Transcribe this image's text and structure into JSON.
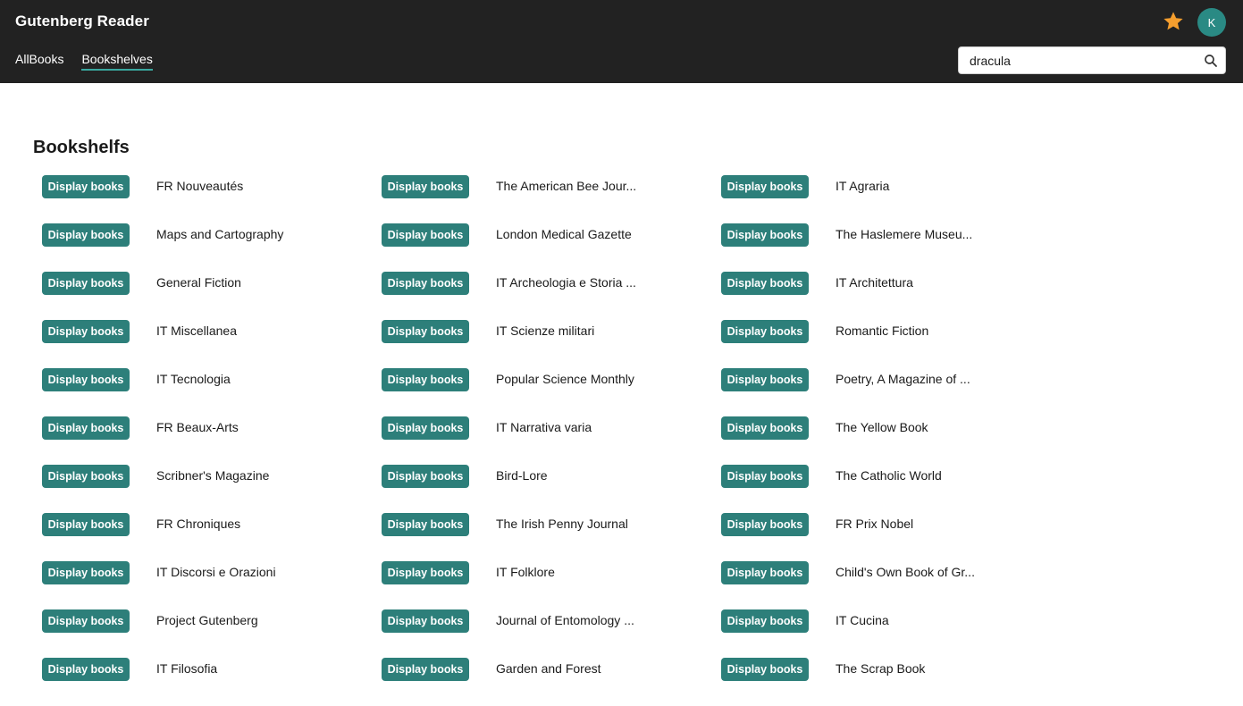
{
  "header": {
    "title": "Gutenberg Reader",
    "nav": [
      {
        "label": "AllBooks",
        "active": false
      },
      {
        "label": "Bookshelves",
        "active": true
      }
    ],
    "favorites_icon": "star-icon",
    "favorites_color": "#f59e2e",
    "avatar_initial": "K",
    "search": {
      "value": "dracula",
      "placeholder": "",
      "icon": "search-icon"
    }
  },
  "section": {
    "title": "Bookshelfs"
  },
  "button_label": "Display books",
  "colors": {
    "topbar": "#222222",
    "accent": "#2d7f7a",
    "nav_underline": "#3aa8a0"
  },
  "shelves": [
    {
      "name": "FR Nouveautés"
    },
    {
      "name": "The American Bee Jour..."
    },
    {
      "name": "IT Agraria"
    },
    {
      "name": "Maps and Cartography"
    },
    {
      "name": "London Medical Gazette"
    },
    {
      "name": "The Haslemere Museu..."
    },
    {
      "name": "General Fiction"
    },
    {
      "name": "IT Archeologia e Storia ..."
    },
    {
      "name": "IT Architettura"
    },
    {
      "name": "IT Miscellanea"
    },
    {
      "name": "IT Scienze militari"
    },
    {
      "name": "Romantic Fiction"
    },
    {
      "name": "IT Tecnologia"
    },
    {
      "name": "Popular Science Monthly"
    },
    {
      "name": "Poetry, A Magazine of ..."
    },
    {
      "name": "FR Beaux-Arts"
    },
    {
      "name": "IT Narrativa varia"
    },
    {
      "name": "The Yellow Book"
    },
    {
      "name": "Scribner's Magazine"
    },
    {
      "name": "Bird-Lore"
    },
    {
      "name": "The Catholic World"
    },
    {
      "name": "FR Chroniques"
    },
    {
      "name": "The Irish Penny Journal"
    },
    {
      "name": "FR Prix Nobel"
    },
    {
      "name": "IT Discorsi e Orazioni"
    },
    {
      "name": "IT Folklore"
    },
    {
      "name": "Child's Own Book of Gr..."
    },
    {
      "name": "Project Gutenberg"
    },
    {
      "name": "Journal of Entomology ..."
    },
    {
      "name": "IT Cucina"
    },
    {
      "name": "IT Filosofia"
    },
    {
      "name": "Garden and Forest"
    },
    {
      "name": "The Scrap Book"
    }
  ]
}
